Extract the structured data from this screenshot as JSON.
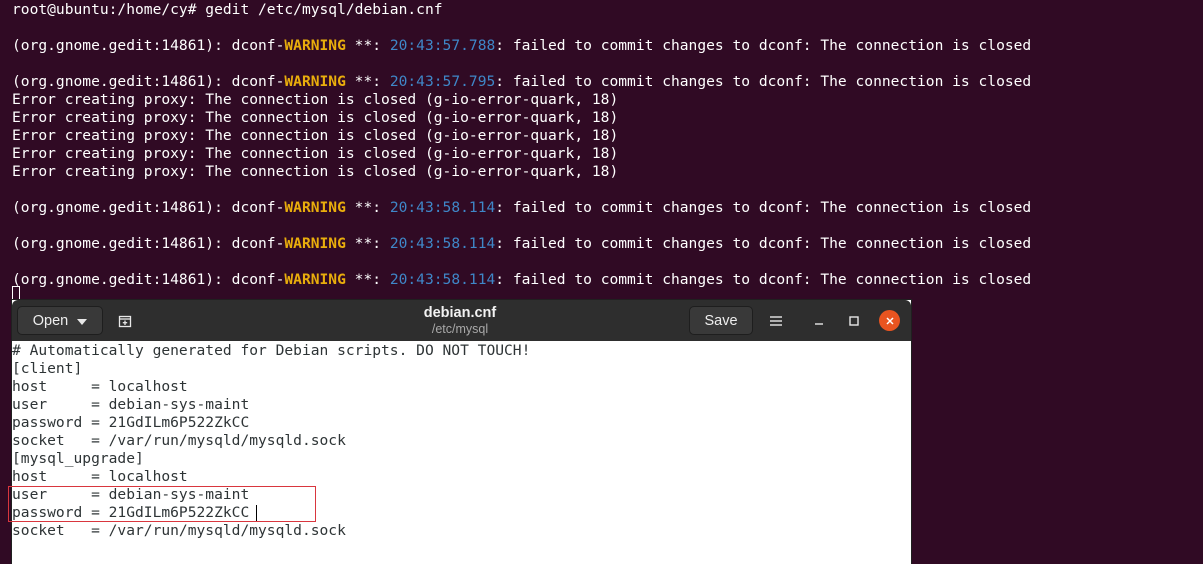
{
  "terminal": {
    "command_line": "root@ubuntu:/home/cy# gedit /etc/mysql/debian.cnf",
    "warning_prefix": "(org.gnome.gedit:14861): dconf-",
    "warning_word": "WARNING",
    "warning_sep": " **: ",
    "warning_message": ": failed to commit changes to dconf: The connection is closed",
    "timestamps": [
      "20:43:57.788",
      "20:43:57.795",
      "20:43:58.114",
      "20:43:58.114",
      "20:43:58.114"
    ],
    "error_line": "Error creating proxy: The connection is closed (g-io-error-quark, 18)"
  },
  "gedit": {
    "open_label": "Open",
    "save_label": "Save",
    "title": "debian.cnf",
    "subtitle": "/etc/mysql",
    "lines": [
      "# Automatically generated for Debian scripts. DO NOT TOUCH!",
      "[client]",
      "host     = localhost",
      "user     = debian-sys-maint",
      "password = 21GdILm6P522ZkCC",
      "socket   = /var/run/mysqld/mysqld.sock",
      "[mysql_upgrade]",
      "host     = localhost",
      "user     = debian-sys-maint",
      "password = 21GdILm6P522ZkCC",
      "socket   = /var/run/mysqld/mysqld.sock"
    ]
  },
  "colors": {
    "terminal_bg": "#300a24",
    "warning": "#e9ad0c",
    "timestamp": "#3f87c8",
    "close_button": "#e95420",
    "highlight_box": "#d9363e"
  }
}
